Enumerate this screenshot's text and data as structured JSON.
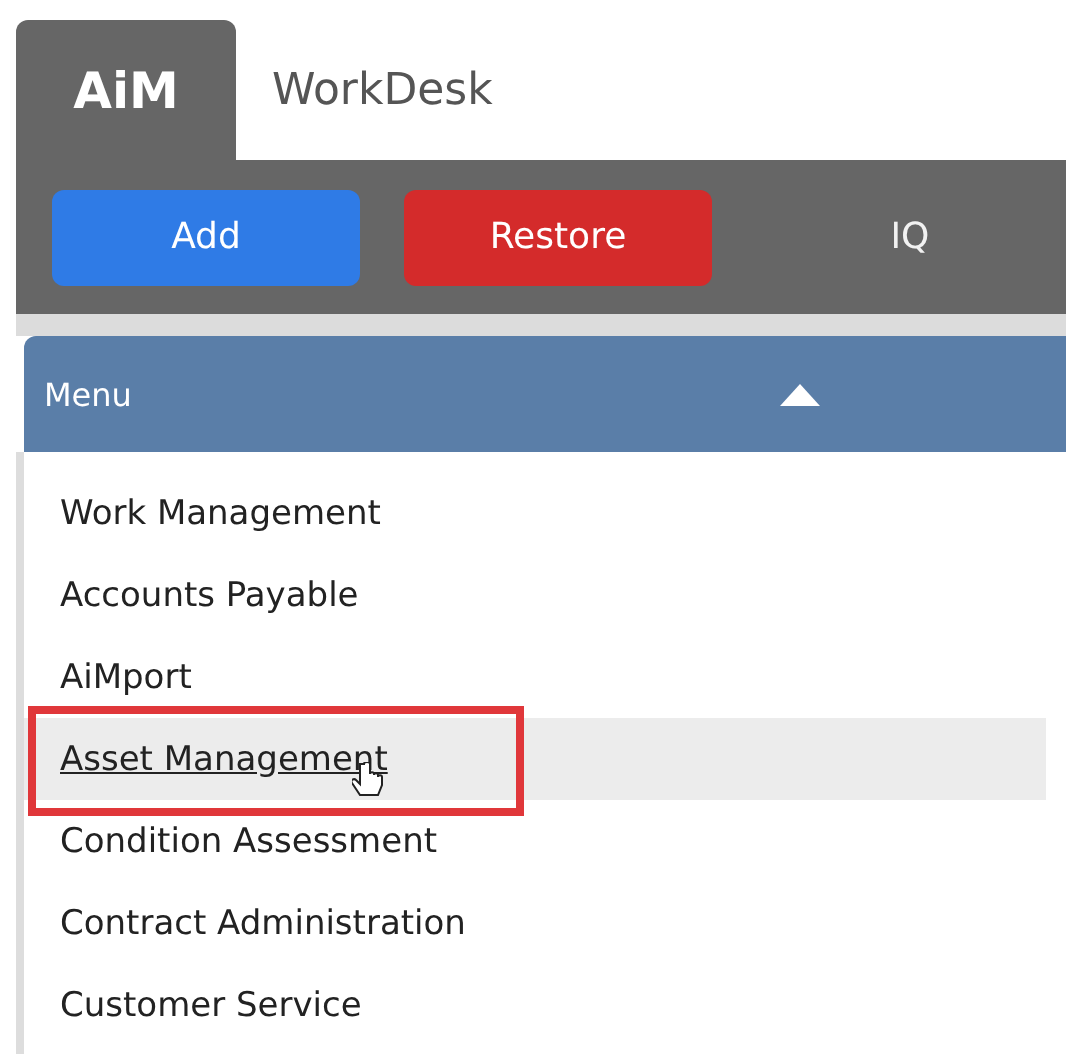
{
  "tabs": [
    {
      "label": "AiM",
      "selected": true
    },
    {
      "label": "WorkDesk",
      "selected": false
    }
  ],
  "toolbar": [
    {
      "label": "Add",
      "kind": "primary"
    },
    {
      "label": "Restore",
      "kind": "danger"
    },
    {
      "label": "IQ",
      "kind": "plain"
    }
  ],
  "menu": {
    "title": "Menu",
    "expanded": true,
    "items": [
      {
        "label": "Work Management",
        "hovered": false,
        "outlined": false
      },
      {
        "label": "Accounts Payable",
        "hovered": false,
        "outlined": false
      },
      {
        "label": "AiMport",
        "hovered": false,
        "outlined": false
      },
      {
        "label": "Asset Management",
        "hovered": true,
        "outlined": true
      },
      {
        "label": "Condition Assessment",
        "hovered": false,
        "outlined": false
      },
      {
        "label": "Contract Administration",
        "hovered": false,
        "outlined": false
      },
      {
        "label": "Customer Service",
        "hovered": false,
        "outlined": false
      }
    ]
  }
}
